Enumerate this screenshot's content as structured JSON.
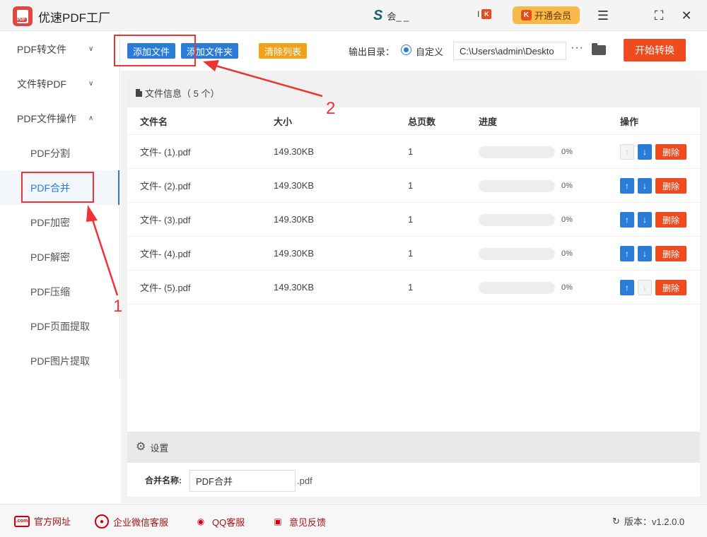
{
  "app": {
    "title": "优速PDF工厂",
    "user_name": "会_ _",
    "vip_mini_prefix": "I",
    "vip_button": "开通会员"
  },
  "sidebar": {
    "groups": [
      {
        "label": "PDF转文件",
        "expanded": false
      },
      {
        "label": "文件转PDF",
        "expanded": false
      },
      {
        "label": "PDF文件操作",
        "expanded": true
      }
    ],
    "sub_items": [
      {
        "label": "PDF分割"
      },
      {
        "label": "PDF合并",
        "active": true
      },
      {
        "label": "PDF加密"
      },
      {
        "label": "PDF解密"
      },
      {
        "label": "PDF压缩"
      },
      {
        "label": "PDF页面提取"
      },
      {
        "label": "PDF图片提取"
      }
    ]
  },
  "toolbar": {
    "add_file": "添加文件",
    "add_folder": "添加文件夹",
    "clear_list": "清除列表",
    "output_label": "输出目录：",
    "radio_custom": "自定义",
    "output_path": "C:\\Users\\admin\\Deskto",
    "more": "···",
    "start": "开始转换"
  },
  "file_panel": {
    "title": "文件信息（ 5 个）",
    "columns": {
      "name": "文件名",
      "size": "大小",
      "pages": "总页数",
      "progress": "进度",
      "ops": "操作"
    },
    "delete_label": "删除",
    "rows": [
      {
        "name": "文件- (1).pdf",
        "size": "149.30KB",
        "pages": "1",
        "progress_pct": 0,
        "progress_text": "0%",
        "up_enabled": false,
        "down_enabled": true
      },
      {
        "name": "文件- (2).pdf",
        "size": "149.30KB",
        "pages": "1",
        "progress_pct": 0,
        "progress_text": "0%",
        "up_enabled": true,
        "down_enabled": true
      },
      {
        "name": "文件- (3).pdf",
        "size": "149.30KB",
        "pages": "1",
        "progress_pct": 0,
        "progress_text": "0%",
        "up_enabled": true,
        "down_enabled": true
      },
      {
        "name": "文件- (4).pdf",
        "size": "149.30KB",
        "pages": "1",
        "progress_pct": 0,
        "progress_text": "0%",
        "up_enabled": true,
        "down_enabled": true
      },
      {
        "name": "文件- (5).pdf",
        "size": "149.30KB",
        "pages": "1",
        "progress_pct": 0,
        "progress_text": "0%",
        "up_enabled": true,
        "down_enabled": false
      }
    ]
  },
  "settings": {
    "title": "设置",
    "merge_label": "合并名称:",
    "merge_value": "PDF合并",
    "merge_ext": ".pdf"
  },
  "annotations": {
    "num1": "1",
    "num2": "2",
    "color": "#ee3333"
  },
  "footer": {
    "website": "官方网址",
    "wechat": "企业微信客服",
    "qq": "QQ客服",
    "feedback": "意见反馈",
    "version": "版本：v1.2.0.0"
  },
  "colors": {
    "primary": "#2b7cd9",
    "danger": "#ef4b1f",
    "warning": "#f4a11a",
    "vip": "#f7b94a"
  }
}
